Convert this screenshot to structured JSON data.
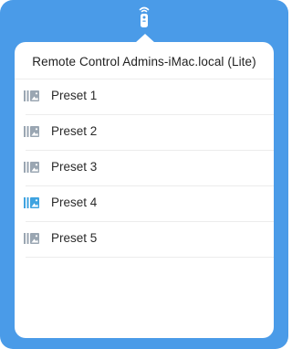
{
  "menubar": {
    "icon": "remote-control-icon"
  },
  "popover": {
    "title": "Remote Control Admins-iMac.local (Lite)"
  },
  "presets": [
    {
      "label": "Preset 1",
      "icon": "preset-icon",
      "active": false
    },
    {
      "label": "Preset 2",
      "icon": "preset-icon",
      "active": false
    },
    {
      "label": "Preset 3",
      "icon": "preset-icon",
      "active": false
    },
    {
      "label": "Preset 4",
      "icon": "preset-icon",
      "active": true
    },
    {
      "label": "Preset 5",
      "icon": "preset-icon",
      "active": false
    }
  ],
  "colors": {
    "background": "#4a9be8",
    "icon_default": "#9aa6b2",
    "icon_active": "#3fa3e0"
  }
}
